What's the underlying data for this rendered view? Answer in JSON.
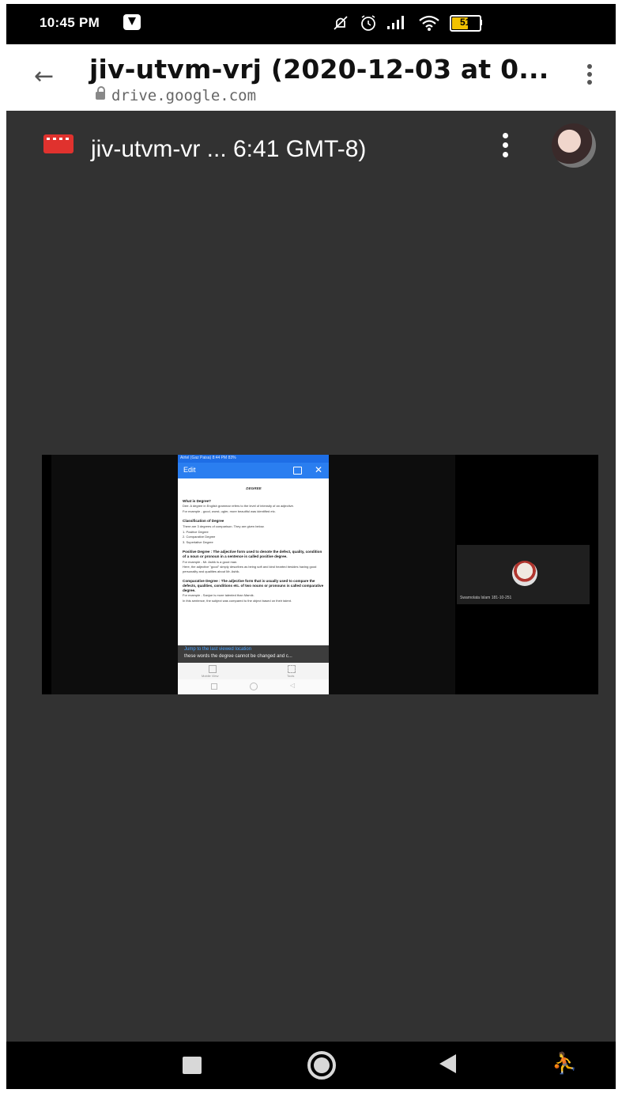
{
  "status_bar": {
    "time": "10:45 PM",
    "battery": "51"
  },
  "title_bar": {
    "title": "jiv-utvm-vrj (2020-12-03 at 0...",
    "url": "drive.google.com",
    "back_icon": "arrow-left-icon",
    "menu_icon": "more-vert-icon"
  },
  "viewer": {
    "file_title": "jiv-utvm-vr ... 6:41 GMT-8)",
    "file_icon": "video-file-icon"
  },
  "video": {
    "participant_name": "Swarnolata Islam 181-10-251",
    "phone": {
      "status_text": "Airtel (Gaz Paisa)   8:44 PM   83%",
      "edit_label": "Edit",
      "doc_title": "DEGREE",
      "doc_lines": [
        {
          "type": "h",
          "text": "What is Degree?"
        },
        {
          "type": "p",
          "text": "Dee: A degree in English grammar refers to the level of intensity of an adjective."
        },
        {
          "type": "p",
          "text": "For example - good, worst, ugler, more beautiful was identified etc."
        },
        {
          "type": "h",
          "text": "Classification of Degree"
        },
        {
          "type": "p",
          "text": "There are 3 degrees of comparison. They are given below."
        },
        {
          "type": "p",
          "text": "1. Positive Degree"
        },
        {
          "type": "p",
          "text": "2. Comparative Degree"
        },
        {
          "type": "p",
          "text": "3. Superlative Degree"
        },
        {
          "type": "h",
          "text": "Positive Degree : The adjective form used to denote the defect, quality, condition of a noun or pronoun in a sentence is called positive degree."
        },
        {
          "type": "p",
          "text": "For example - Mr. Ashik is a good man."
        },
        {
          "type": "p",
          "text": "Here, the adjective \"good\" simply describes as being soft and kind hearted besides having good personality and qualities about Mr. Ashik."
        },
        {
          "type": "h",
          "text": "Comparative Degree : The adjective form that is usually used to compare the defects, qualities, conditions etc. of two nouns or pronouns is called comparative degree."
        },
        {
          "type": "p",
          "text": "For example - Sanjue is more talented than Mamik."
        },
        {
          "type": "p",
          "text": "In this sentence, the subject was compared to the object based on their talent."
        }
      ],
      "jump_label": "Jump to the last viewed location",
      "jump_text": "these words the degree cannot be changed and c...",
      "toolbar_left": "Mobile View",
      "toolbar_right": "Tools"
    }
  },
  "nav_bar": {
    "recents_icon": "square-recents-icon",
    "home_icon": "circle-home-icon",
    "back_icon": "triangle-back-icon",
    "accessibility_icon": "accessibility-icon"
  }
}
